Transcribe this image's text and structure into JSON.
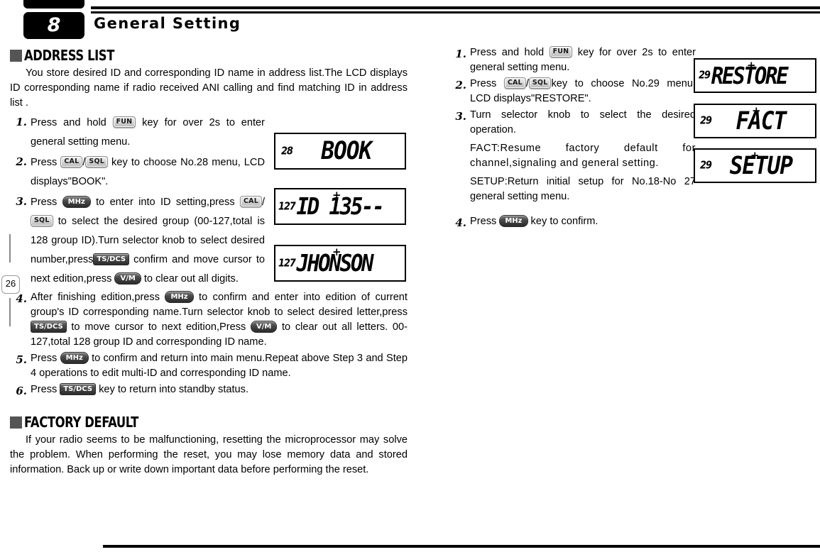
{
  "header": {
    "chapter_number": "8",
    "title": "General Setting"
  },
  "page_number": "26",
  "left_column": {
    "section1": {
      "heading": "ADDRESS LIST",
      "intro": "You store desired ID and corresponding ID name in address list.The LCD displays ID corresponding name if radio received ANI calling and find matching ID in address list .",
      "steps": [
        {
          "num": "1.",
          "parts": [
            {
              "t": "text",
              "v": "Press and hold "
            },
            {
              "t": "key",
              "style": "light",
              "v": "FUN"
            },
            {
              "t": "text",
              "v": " key for over 2s to enter general setting menu."
            }
          ]
        },
        {
          "num": "2.",
          "parts": [
            {
              "t": "text",
              "v": "Press "
            },
            {
              "t": "key",
              "style": "light",
              "v": "CAL"
            },
            {
              "t": "text",
              "v": "/"
            },
            {
              "t": "key",
              "style": "light",
              "v": "SQL"
            },
            {
              "t": "text",
              "v": " key to choose No.28 menu, LCD displays\"BOOK\"."
            }
          ]
        },
        {
          "num": "3.",
          "parts": [
            {
              "t": "text",
              "v": "Press "
            },
            {
              "t": "key",
              "style": "dark",
              "v": "MHz"
            },
            {
              "t": "text",
              "v": " to enter into ID setting,press "
            },
            {
              "t": "key",
              "style": "light",
              "v": "CAL"
            },
            {
              "t": "text",
              "v": "/"
            },
            {
              "t": "key",
              "style": "light",
              "v": "SQL"
            },
            {
              "t": "text",
              "v": " to select the desired group (00-127,total is 128 group ID).Turn selector knob to select desired number,press"
            },
            {
              "t": "key",
              "style": "dark-sq",
              "v": "TS/DCS"
            },
            {
              "t": "text",
              "v": " confirm and move cursor to next edition,press "
            },
            {
              "t": "key",
              "style": "dark",
              "v": "V/M"
            },
            {
              "t": "text",
              "v": " to clear out all digits."
            }
          ]
        },
        {
          "num": "4.",
          "parts": [
            {
              "t": "text",
              "v": "After finishing edition,press "
            },
            {
              "t": "key",
              "style": "dark",
              "v": "MHz"
            },
            {
              "t": "text",
              "v": " to confirm and enter into edition of current group's ID corresponding name.Turn selector knob to select desired letter,press "
            },
            {
              "t": "key",
              "style": "dark-sq",
              "v": "TS/DCS"
            },
            {
              "t": "text",
              "v": " to move cursor to next edition,Press "
            },
            {
              "t": "key",
              "style": "dark",
              "v": "V/M"
            },
            {
              "t": "text",
              "v": " to clear out all letters. 00-127,total 128 group ID and corresponding ID name."
            }
          ]
        },
        {
          "num": "5.",
          "parts": [
            {
              "t": "text",
              "v": "Press "
            },
            {
              "t": "key",
              "style": "dark",
              "v": "MHz"
            },
            {
              "t": "text",
              "v": " to confirm and return into main menu.Repeat above Step 3 and Step 4 operations to edit multi-ID and corresponding ID name."
            }
          ]
        },
        {
          "num": "6.",
          "parts": [
            {
              "t": "text",
              "v": "Press "
            },
            {
              "t": "key",
              "style": "dark-sq",
              "v": "TS/DCS"
            },
            {
              "t": "text",
              "v": " key to return into standby status."
            }
          ]
        }
      ]
    },
    "section2": {
      "heading": "FACTORY DEFAULT",
      "intro": "If your radio seems to be malfunctioning, resetting the microprocessor may solve the problem. When performing the reset, you may lose memory data and stored information. Back up or write down important data before performing the reset."
    },
    "lcds": [
      {
        "channel": "28",
        "main": "BOOK",
        "plus": false
      },
      {
        "channel": "127",
        "main": "ID 135--",
        "plus": true
      },
      {
        "channel": "127",
        "main": "JHONSON",
        "plus": true
      }
    ]
  },
  "right_column": {
    "steps": [
      {
        "num": "1.",
        "parts": [
          {
            "t": "text",
            "v": "Press and hold "
          },
          {
            "t": "key",
            "style": "light",
            "v": "FUN"
          },
          {
            "t": "text",
            "v": " key for over 2s to enter general setting menu."
          }
        ]
      },
      {
        "num": "2.",
        "parts": [
          {
            "t": "text",
            "v": "Press "
          },
          {
            "t": "key",
            "style": "light",
            "v": "CAL"
          },
          {
            "t": "text",
            "v": "/"
          },
          {
            "t": "key",
            "style": "light",
            "v": "SQL"
          },
          {
            "t": "text",
            "v": "key to choose No.29 menu, LCD displays\"RESTORE\"."
          }
        ]
      },
      {
        "num": "3.",
        "parts": [
          {
            "t": "text",
            "v": "Turn selector knob to select the desired operation."
          }
        ]
      },
      {
        "num": "4.",
        "parts": [
          {
            "t": "text",
            "v": "Press "
          },
          {
            "t": "key",
            "style": "dark",
            "v": "MHz"
          },
          {
            "t": "text",
            "v": " key to confirm."
          }
        ]
      }
    ],
    "notes": [
      "FACT:Resume factory default for channel,signaling and  general setting.",
      "SETUP:Return initial setup for No.18-No 27 general setting menu."
    ],
    "lcds": [
      {
        "channel": "29",
        "main": "RESTORE",
        "plus": true
      },
      {
        "channel": "29",
        "main": "FACT",
        "plus": true
      },
      {
        "channel": "29",
        "main": "SETUP",
        "plus": true
      }
    ]
  }
}
